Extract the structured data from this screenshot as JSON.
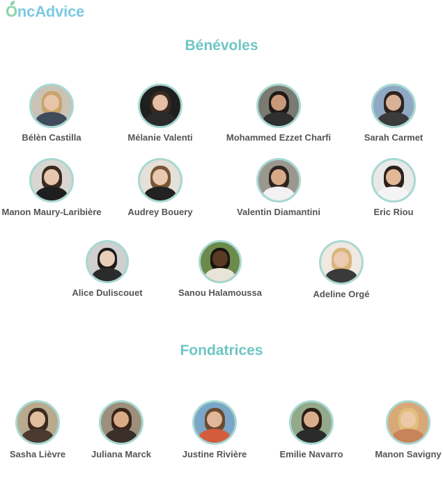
{
  "brand": {
    "logo_o": "O",
    "logo_rest": "ncAdvice"
  },
  "sections": {
    "volunteers_title": "Bénévoles",
    "founders_title": "Fondatrices"
  },
  "volunteers": [
    {
      "name": "Bélèn Castilla",
      "bg": "#c9c2b5",
      "skin": "#e8c4a8",
      "hair": "#c9a36a",
      "shirt": "#3f4a5a"
    },
    {
      "name": "Mélanie Valenti",
      "bg": "#1f1f1f",
      "skin": "#e4bfa3",
      "hair": "#3a2a20",
      "shirt": "#2a2a2a"
    },
    {
      "name": "Mohammed Ezzet Charfi",
      "bg": "#7a7a72",
      "skin": "#c99878",
      "hair": "#1f1a18",
      "shirt": "#2f2f2f"
    },
    {
      "name": "Sarah Carmet",
      "bg": "#8fa9c4",
      "skin": "#d9b196",
      "hair": "#2e241e",
      "shirt": "#3b3b3b"
    },
    {
      "name": "Manon Maury-Laribière",
      "bg": "#d9d6d1",
      "skin": "#e7c6ae",
      "hair": "#3b2a1f",
      "shirt": "#1f1f1f"
    },
    {
      "name": "Audrey Bouery",
      "bg": "#e5e0d8",
      "skin": "#eac9b2",
      "hair": "#7a5636",
      "shirt": "#222222"
    },
    {
      "name": "Valentin Diamantini",
      "bg": "#9a978f",
      "skin": "#d8aa88",
      "hair": "#2c2420",
      "shirt": "#f2f2f2"
    },
    {
      "name": "Eric Riou",
      "bg": "#e9e9e9",
      "skin": "#e2b897",
      "hair": "#2a211c",
      "shirt": "#f4f4f4"
    },
    {
      "name": "Alice Duliscouet",
      "bg": "#cfcfcf",
      "skin": "#e8cdb9",
      "hair": "#1e1a18",
      "shirt": "#2b2b2b"
    },
    {
      "name": "Sanou Halamoussa",
      "bg": "#6b8a4c",
      "skin": "#5b3a24",
      "hair": "#1a1410",
      "shirt": "#e9e4d8"
    },
    {
      "name": "Adeline Orgé",
      "bg": "#efe9e2",
      "skin": "#eccbb3",
      "hair": "#d8b578",
      "shirt": "#3a3a3a"
    }
  ],
  "founders": [
    {
      "name": "Sasha Lièvre",
      "bg": "#b9a98d",
      "skin": "#e2bea0",
      "hair": "#3d2a1e",
      "shirt": "#4a3a30"
    },
    {
      "name": "Juliana Marck",
      "bg": "#9c8f7c",
      "skin": "#d9ac86",
      "hair": "#3a2518",
      "shirt": "#3b2f2a"
    },
    {
      "name": "Justine Rivière",
      "bg": "#7aa6c8",
      "skin": "#e0b899",
      "hair": "#6b4a30",
      "shirt": "#d25c3d"
    },
    {
      "name": "Emilie Navarro",
      "bg": "#93a98a",
      "skin": "#d8ae8c",
      "hair": "#2c1d14",
      "shirt": "#2b2b2b"
    },
    {
      "name": "Manon Savigny",
      "bg": "#d9a878",
      "skin": "#edc9a9",
      "hair": "#e0c07a",
      "shirt": "#c9835a"
    }
  ]
}
